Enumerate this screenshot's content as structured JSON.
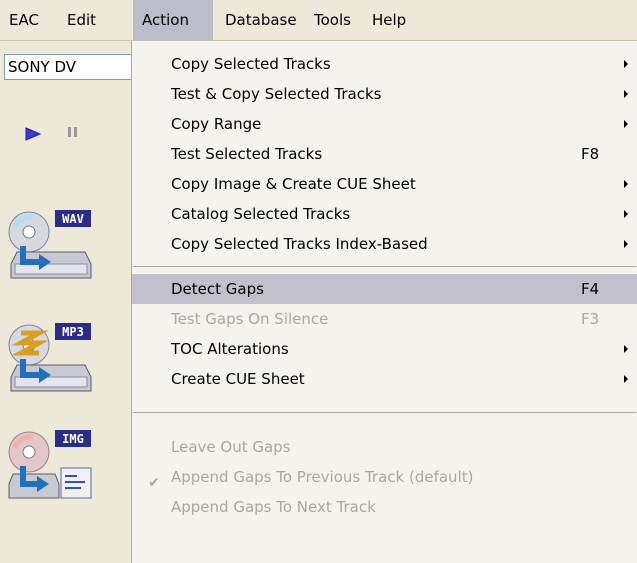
{
  "menubar": {
    "items": [
      "EAC",
      "Edit",
      "Action",
      "Database",
      "Tools",
      "Help"
    ],
    "active": "Action"
  },
  "left": {
    "drive_value": "SONY DV",
    "icons": [
      "play-icon",
      "pause-icon",
      "copy-to-wav-icon",
      "copy-to-mp3-icon",
      "copy-image-icon"
    ],
    "badges": {
      "wav": "WAV",
      "mp3": "MP3",
      "img": "IMG"
    }
  },
  "menu": {
    "items": [
      {
        "label": "Copy Selected Tracks",
        "submenu": true
      },
      {
        "label": "Test & Copy Selected Tracks",
        "submenu": true
      },
      {
        "label": "Copy Range",
        "submenu": true
      },
      {
        "label": "Test Selected Tracks",
        "shortcut": "F8"
      },
      {
        "label": "Copy Image & Create CUE Sheet",
        "submenu": true
      },
      {
        "label": "Catalog Selected Tracks",
        "submenu": true
      },
      {
        "label": "Copy Selected Tracks Index-Based",
        "submenu": true
      },
      {
        "label": "Detect Gaps",
        "shortcut": "F4",
        "highlighted": true
      },
      {
        "label": "Test Gaps On Silence",
        "shortcut": "F3",
        "disabled": true
      },
      {
        "label": "TOC Alterations",
        "submenu": true
      },
      {
        "label": "Create CUE Sheet",
        "submenu": true
      },
      {
        "label": "Leave Out Gaps",
        "disabled": true
      },
      {
        "label": "Append Gaps To Previous Track (default)",
        "disabled": true,
        "checked": true
      },
      {
        "label": "Append Gaps To Next Track",
        "disabled": true
      }
    ]
  },
  "colors": {
    "menubar_bg": "#ece9d8",
    "menu_bg": "#f4f3ee",
    "highlight": "#c1c0cc",
    "disabled_text": "#a9a89f"
  }
}
